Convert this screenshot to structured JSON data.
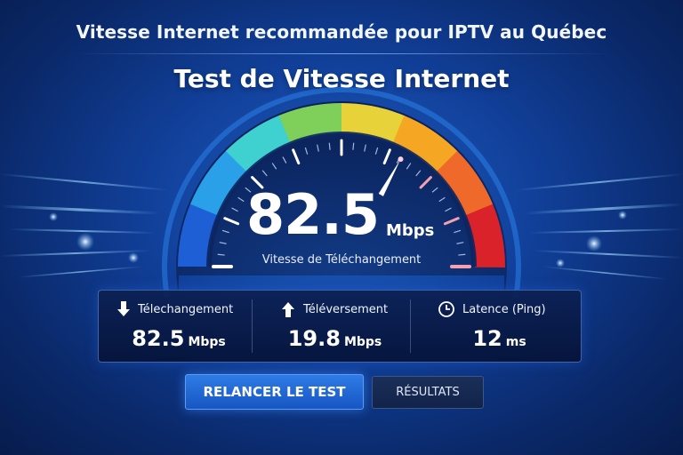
{
  "header": {
    "top_title": "Vitesse Internet recommandée pour IPTV au Québec",
    "main_title": "Test de Vitesse Internet"
  },
  "gauge": {
    "value": "82.5",
    "unit": "Mbps",
    "label": "Vitesse de Téléchangement",
    "needle_fraction": 0.66,
    "colors": [
      "#1e5fd6",
      "#2aa0e8",
      "#3fd0d0",
      "#7fd05a",
      "#e8d23a",
      "#f5a623",
      "#ef6a2a",
      "#d9222a"
    ]
  },
  "stats": [
    {
      "icon": "arrow-down-icon",
      "name": "Télechangement",
      "value": "82.5",
      "unit": "Mbps"
    },
    {
      "icon": "arrow-up-icon",
      "name": "Téléversement",
      "value": "19.8",
      "unit": "Mbps"
    },
    {
      "icon": "clock-icon",
      "name": "Latence (Ping)",
      "value": "12",
      "unit": "ms"
    }
  ],
  "actions": {
    "primary_label": "RELANCER LE TEST",
    "secondary_label": "RÉSULTATS"
  }
}
